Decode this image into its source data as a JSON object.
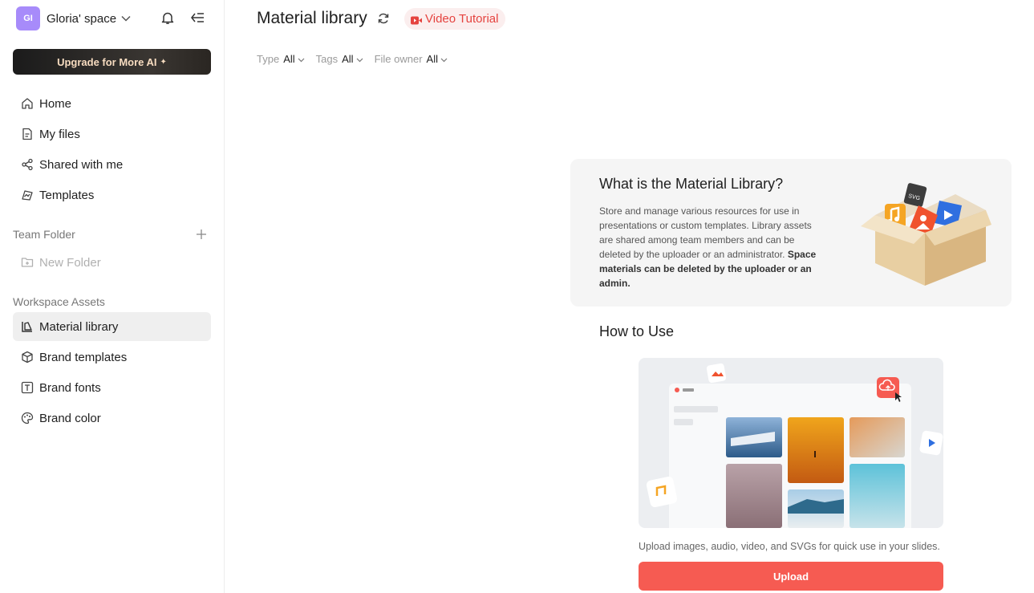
{
  "workspace": {
    "avatar_initials": "GI",
    "name": "Gloria' space"
  },
  "sidebar": {
    "upgrade_label": "Upgrade for More AI",
    "nav": [
      {
        "label": "Home",
        "icon": "home-icon"
      },
      {
        "label": "My files",
        "icon": "file-icon"
      },
      {
        "label": "Shared with me",
        "icon": "share-icon"
      },
      {
        "label": "Templates",
        "icon": "template-icon"
      }
    ],
    "team_folder_title": "Team Folder",
    "new_folder_label": "New Folder",
    "workspace_assets_title": "Workspace Assets",
    "assets": [
      {
        "label": "Material library",
        "icon": "library-icon",
        "active": true
      },
      {
        "label": "Brand templates",
        "icon": "cube-icon"
      },
      {
        "label": "Brand fonts",
        "icon": "font-icon"
      },
      {
        "label": "Brand color",
        "icon": "palette-icon"
      }
    ]
  },
  "main": {
    "title": "Material library",
    "video_tutorial_label": "Video Tutorial",
    "filters": [
      {
        "label": "Type",
        "value": "All"
      },
      {
        "label": "Tags",
        "value": "All"
      },
      {
        "label": "File owner",
        "value": "All"
      }
    ],
    "info": {
      "title": "What is the Material Library?",
      "text": "Store and manage various resources for use in presentations or custom templates. Library assets are shared among team members and can be deleted by the uploader or an administrator.",
      "bold_text": "Space materials can be deleted by the uploader or an admin.",
      "svg_badge": "SVG"
    },
    "how_to_use_title": "How to Use",
    "upload_note": "Upload images, audio, video, and SVGs for quick use in your slides.",
    "upload_label": "Upload"
  },
  "colors": {
    "accent": "#f65b52",
    "video_red": "#e5433f",
    "active_bg": "#efefef"
  }
}
